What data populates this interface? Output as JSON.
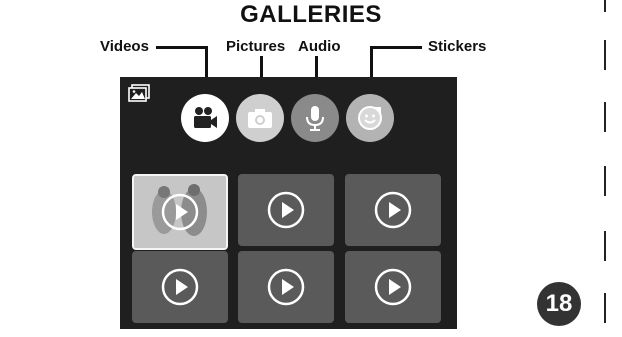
{
  "title": "GALLERIES",
  "callouts": {
    "videos": "Videos",
    "pictures": "Pictures",
    "audio": "Audio",
    "stickers": "Stickers"
  },
  "page_number": "18",
  "screen": {
    "corner_icon": "picture-gallery-icon",
    "tabs": [
      {
        "icon": "video-camera-icon",
        "selected": true
      },
      {
        "icon": "photo-camera-icon",
        "selected": false
      },
      {
        "icon": "microphone-icon",
        "selected": false
      },
      {
        "icon": "sticker-face-icon",
        "selected": false
      }
    ],
    "tiles": [
      {
        "type": "video-thumbnail",
        "selected": true
      },
      {
        "type": "video-placeholder",
        "selected": false
      },
      {
        "type": "video-placeholder",
        "selected": false
      },
      {
        "type": "video-placeholder",
        "selected": false
      },
      {
        "type": "video-placeholder",
        "selected": false
      },
      {
        "type": "video-placeholder",
        "selected": false
      }
    ]
  },
  "colors": {
    "screen_bg": "#1f1f1f",
    "tile_bg": "#5a5a5a",
    "tab_selected": "#ffffff",
    "tab_unselected": "#8a8a8a"
  }
}
